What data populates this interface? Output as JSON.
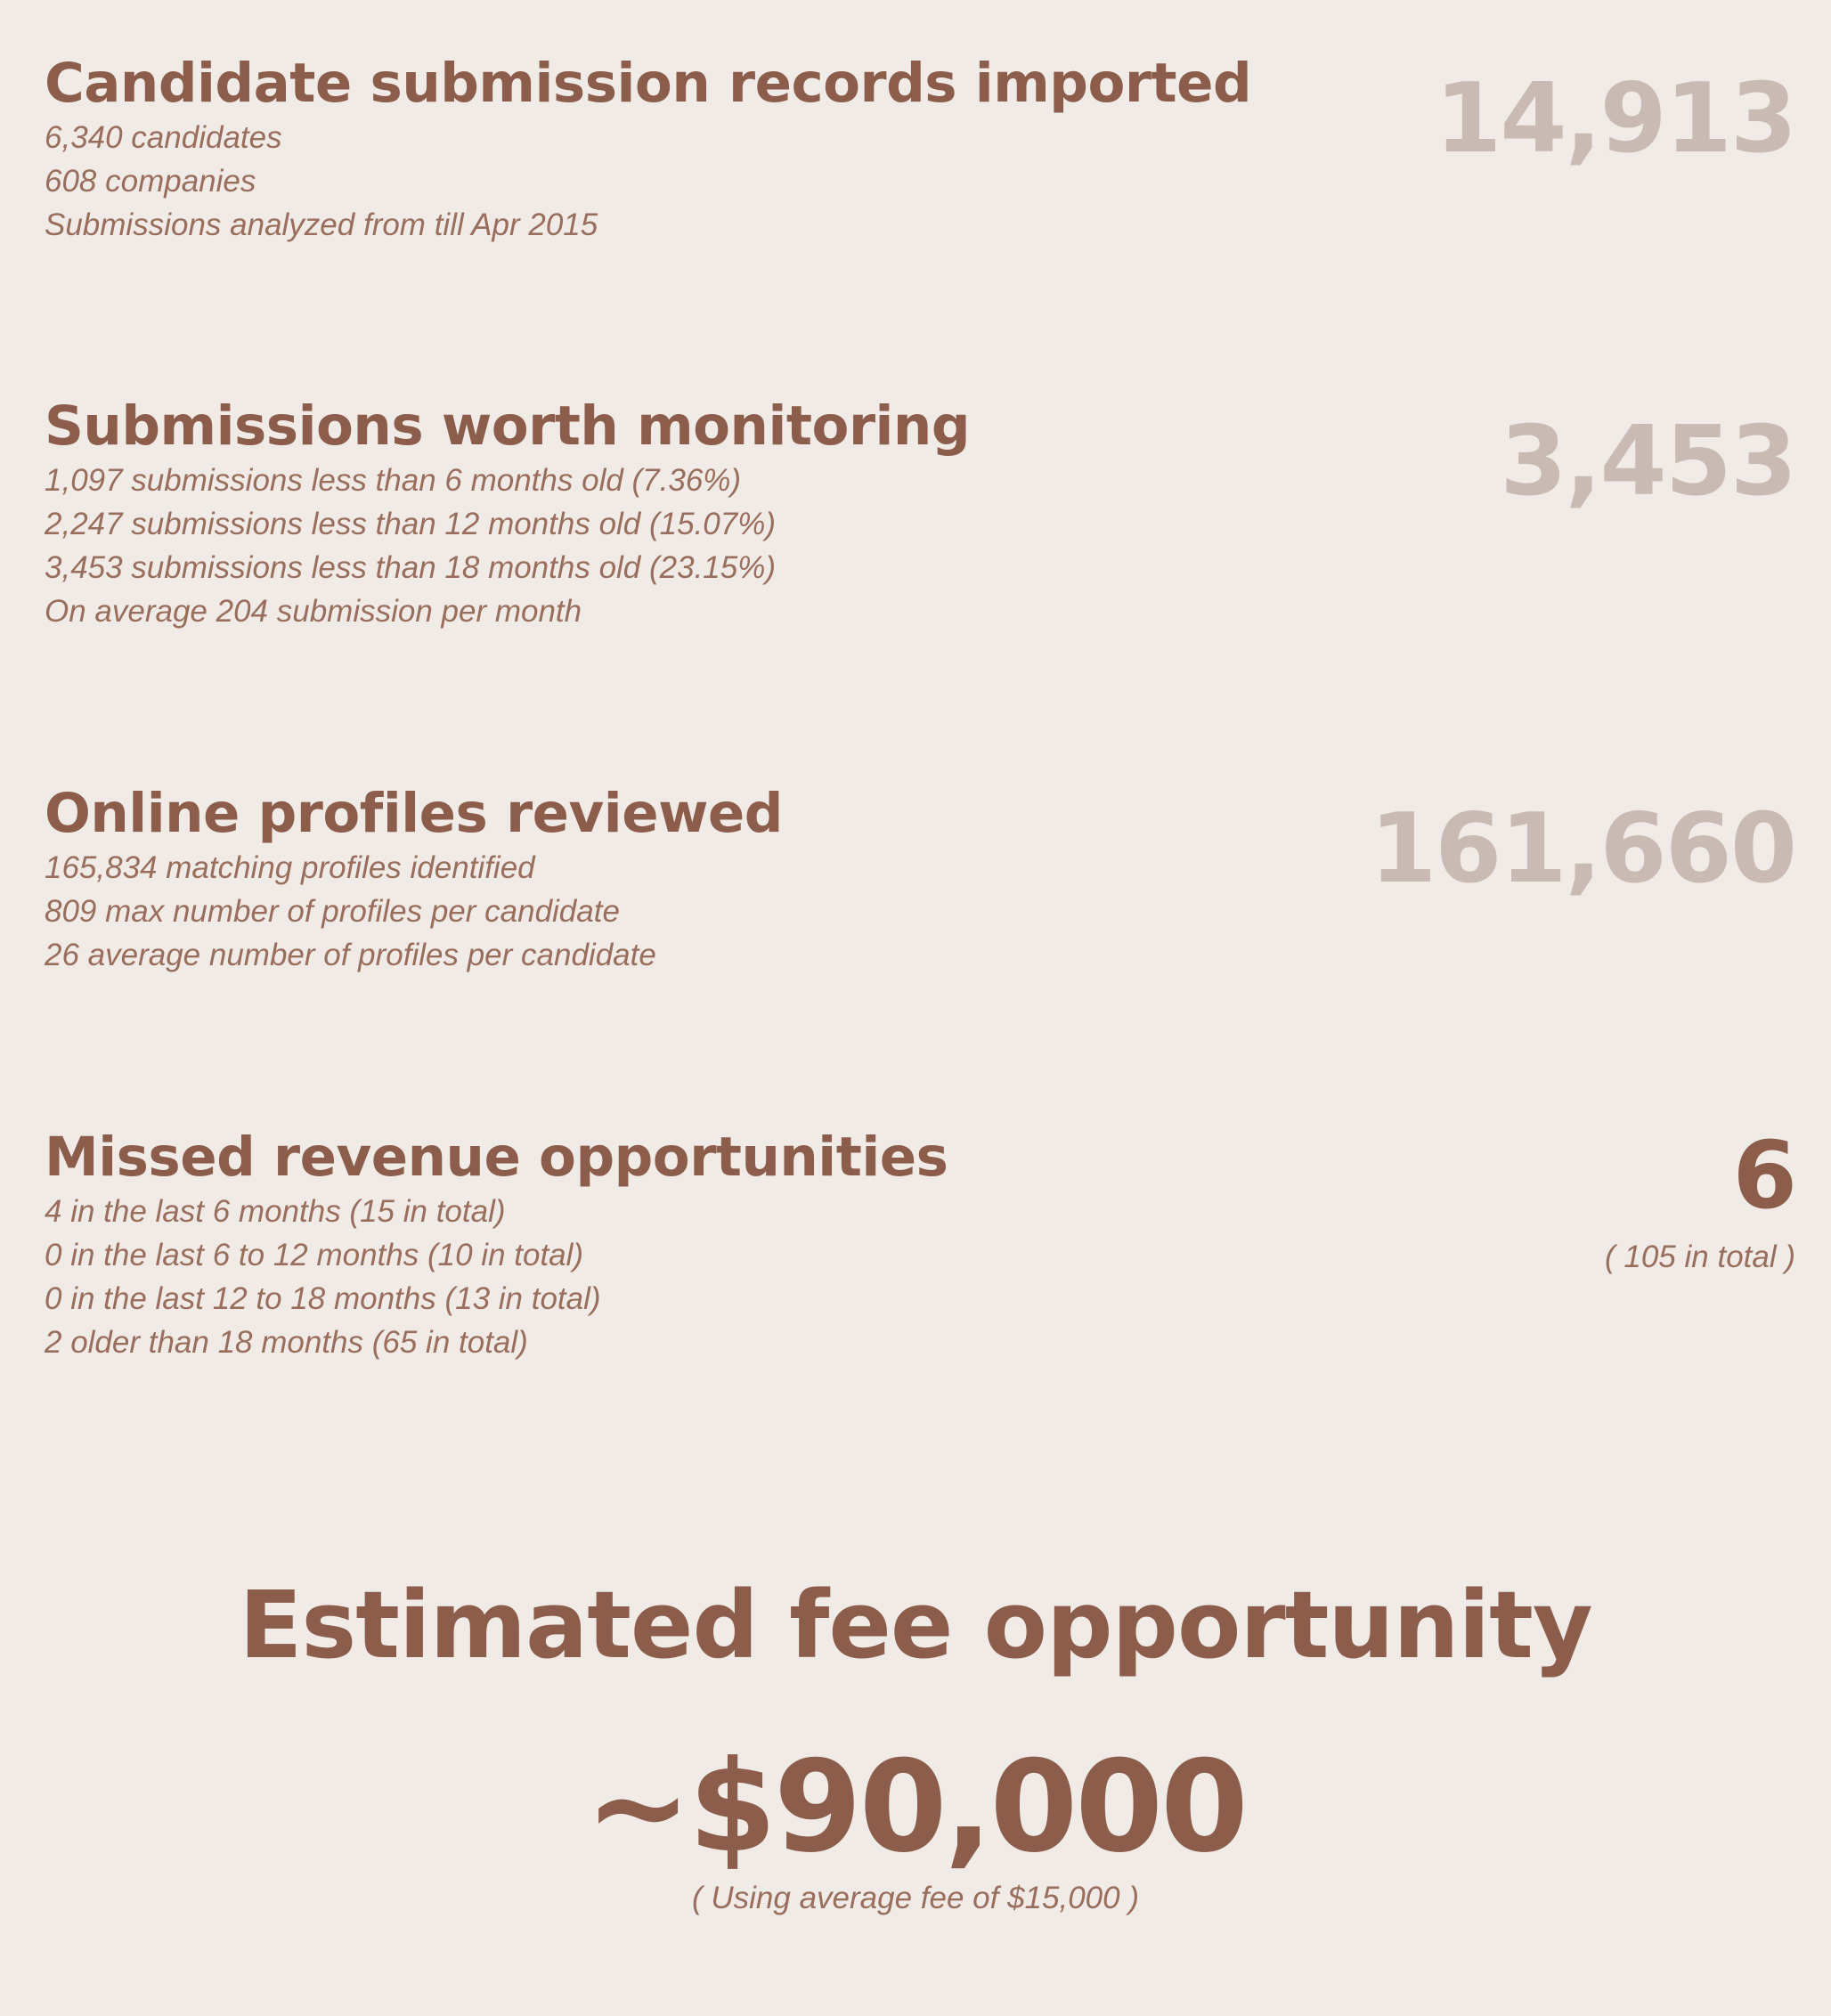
{
  "sections": [
    {
      "title": "Candidate submission records imported",
      "details": [
        "6,340 candidates",
        "608 companies",
        "Submissions analyzed from till Apr 2015"
      ],
      "stat": "14,913"
    },
    {
      "title": "Submissions worth monitoring",
      "details": [
        "1,097 submissions less than 6 months old (7.36%)",
        "2,247 submissions less than 12 months old (15.07%)",
        "3,453 submissions less than 18 months old (23.15%)",
        "On average 204 submission per month"
      ],
      "stat": "3,453"
    },
    {
      "title": "Online profiles reviewed",
      "details": [
        "165,834 matching profiles identified",
        "809 max number of profiles per candidate",
        "26 average number of profiles per candidate"
      ],
      "stat": "161,660"
    },
    {
      "title": "Missed revenue opportunities",
      "details": [
        "4 in the last 6 months (15 in total)",
        "0 in the last 6 to 12 months (10 in total)",
        "0 in the last 12 to 18 months (13 in total)",
        "2 older than 18 months (65 in total)"
      ],
      "stat": "6",
      "stat_sub": "( 105 in total )"
    }
  ],
  "fee": {
    "title": "Estimated fee opportunity",
    "amount": "~$90,000",
    "note": "( Using average fee of $15,000 )"
  },
  "colors": {
    "background": "#f0ebe6",
    "primary_text": "#8c5d4b",
    "muted_stat": "#c9bbb3"
  }
}
